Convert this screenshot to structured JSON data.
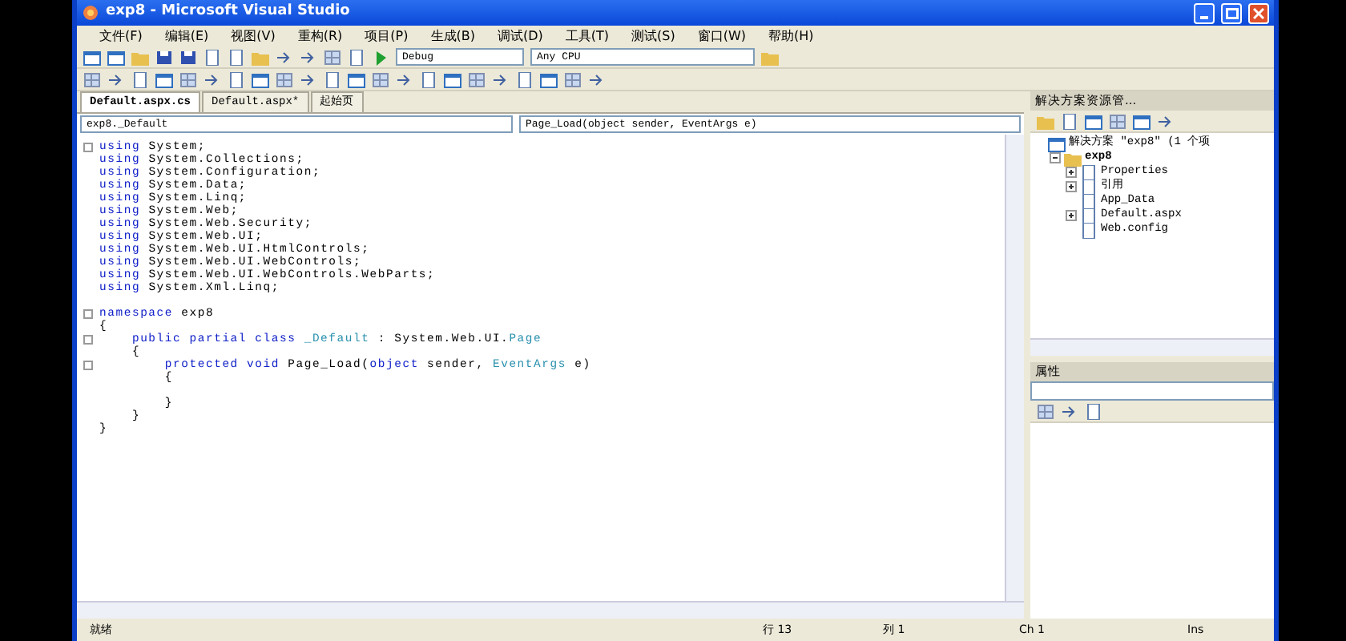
{
  "window": {
    "title": "exp8 - Microsoft Visual Studio"
  },
  "menu": [
    "文件(F)",
    "编辑(E)",
    "视图(V)",
    "重构(R)",
    "项目(P)",
    "生成(B)",
    "调试(D)",
    "工具(T)",
    "测试(S)",
    "窗口(W)",
    "帮助(H)"
  ],
  "toolbar": {
    "configuration": "Debug",
    "platform": "Any CPU"
  },
  "tabs": [
    {
      "label": "Default.aspx.cs",
      "selected": true
    },
    {
      "label": "Default.aspx*",
      "selected": false
    },
    {
      "label": "起始页",
      "selected": false
    }
  ],
  "navigation": {
    "class_combo": "exp8._Default",
    "member_combo": "Page_Load(object sender, EventArgs e)"
  },
  "code_lines": [
    {
      "fold": true,
      "tokens": [
        {
          "kind": "keyword",
          "text": "using"
        },
        {
          "kind": "plain",
          "text": " System;"
        }
      ]
    },
    {
      "fold": false,
      "tokens": [
        {
          "kind": "keyword",
          "text": "using"
        },
        {
          "kind": "plain",
          "text": " System.Collections;"
        }
      ]
    },
    {
      "fold": false,
      "tokens": [
        {
          "kind": "keyword",
          "text": "using"
        },
        {
          "kind": "plain",
          "text": " System.Configuration;"
        }
      ]
    },
    {
      "fold": false,
      "tokens": [
        {
          "kind": "keyword",
          "text": "using"
        },
        {
          "kind": "plain",
          "text": " System.Data;"
        }
      ]
    },
    {
      "fold": false,
      "tokens": [
        {
          "kind": "keyword",
          "text": "using"
        },
        {
          "kind": "plain",
          "text": " System.Linq;"
        }
      ]
    },
    {
      "fold": false,
      "tokens": [
        {
          "kind": "keyword",
          "text": "using"
        },
        {
          "kind": "plain",
          "text": " System.Web;"
        }
      ]
    },
    {
      "fold": false,
      "tokens": [
        {
          "kind": "keyword",
          "text": "using"
        },
        {
          "kind": "plain",
          "text": " System.Web.Security;"
        }
      ]
    },
    {
      "fold": false,
      "tokens": [
        {
          "kind": "keyword",
          "text": "using"
        },
        {
          "kind": "plain",
          "text": " System.Web.UI;"
        }
      ]
    },
    {
      "fold": false,
      "tokens": [
        {
          "kind": "keyword",
          "text": "using"
        },
        {
          "kind": "plain",
          "text": " System.Web.UI.HtmlControls;"
        }
      ]
    },
    {
      "fold": false,
      "tokens": [
        {
          "kind": "keyword",
          "text": "using"
        },
        {
          "kind": "plain",
          "text": " System.Web.UI.WebControls;"
        }
      ]
    },
    {
      "fold": false,
      "tokens": [
        {
          "kind": "keyword",
          "text": "using"
        },
        {
          "kind": "plain",
          "text": " System.Web.UI.WebControls.WebParts;"
        }
      ]
    },
    {
      "fold": false,
      "tokens": [
        {
          "kind": "keyword",
          "text": "using"
        },
        {
          "kind": "plain",
          "text": " System.Xml.Linq;"
        }
      ]
    },
    {
      "fold": false
    },
    {
      "fold": true,
      "tokens": [
        {
          "kind": "keyword",
          "text": "namespace"
        },
        {
          "kind": "plain",
          "text": " exp8"
        }
      ]
    },
    {
      "fold": false,
      "tokens": [
        {
          "kind": "plain",
          "text": "{"
        }
      ]
    },
    {
      "fold": true,
      "tokens": [
        {
          "kind": "keyword",
          "text": "    public partial class"
        },
        {
          "kind": "type",
          "text": " _Default"
        },
        {
          "kind": "plain",
          "text": " : System.Web.UI."
        },
        {
          "kind": "type",
          "text": "Page"
        }
      ]
    },
    {
      "fold": false,
      "tokens": [
        {
          "kind": "plain",
          "text": "    {"
        }
      ]
    },
    {
      "fold": true,
      "tokens": [
        {
          "kind": "keyword",
          "text": "        protected void"
        },
        {
          "kind": "plain",
          "text": " Page_Load("
        },
        {
          "kind": "keyword",
          "text": "object"
        },
        {
          "kind": "plain",
          "text": " sender, "
        },
        {
          "kind": "type",
          "text": "EventArgs"
        },
        {
          "kind": "plain",
          "text": " e)"
        }
      ]
    },
    {
      "fold": false,
      "tokens": [
        {
          "kind": "plain",
          "text": "        {"
        }
      ]
    },
    {
      "fold": false
    },
    {
      "fold": false,
      "tokens": [
        {
          "kind": "plain",
          "text": "        }"
        }
      ]
    },
    {
      "fold": false,
      "tokens": [
        {
          "kind": "plain",
          "text": "    }"
        }
      ]
    },
    {
      "fold": false,
      "tokens": [
        {
          "kind": "plain",
          "text": "}"
        }
      ]
    }
  ],
  "solution_explorer": {
    "title": "解决方案资源管...",
    "tree": [
      {
        "label": "解决方案 \"exp8\" (1 个项",
        "children": [
          {
            "label": "exp8",
            "expanded": true,
            "children": [
              {
                "label": "Properties",
                "expanded": false
              },
              {
                "label": "引用",
                "expanded": false
              },
              {
                "label": "App_Data"
              },
              {
                "label": "Default.aspx",
                "expanded": false
              },
              {
                "label": "Web.config"
              }
            ]
          }
        ]
      }
    ]
  },
  "properties": {
    "title": "属性"
  },
  "status_bar": {
    "message": "就绪",
    "line": "行 13",
    "column": "列 1",
    "char": "Ch 1",
    "mode": "Ins"
  }
}
